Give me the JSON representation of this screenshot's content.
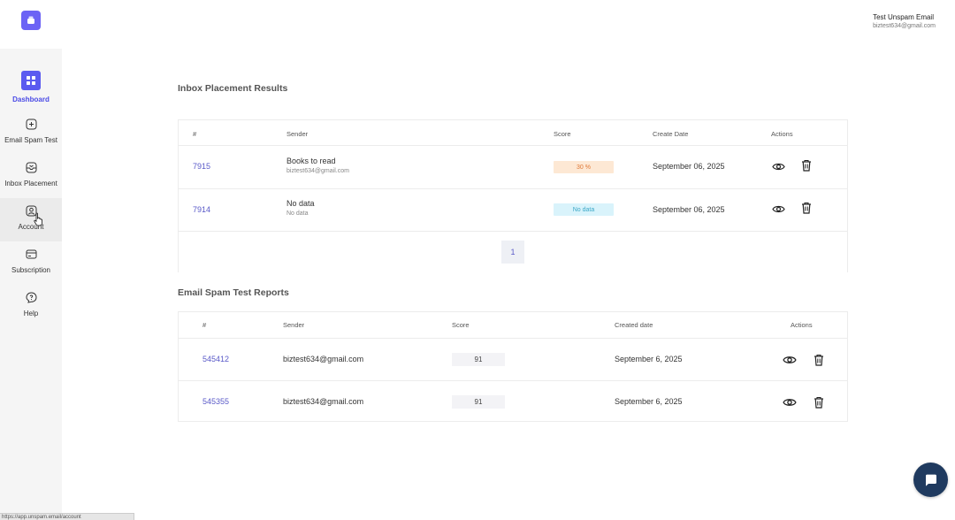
{
  "sidebar": {
    "items": [
      {
        "label": "Dashboard",
        "icon": "grid-icon"
      },
      {
        "label": "Email Spam Test",
        "icon": "plus-square-icon"
      },
      {
        "label": "Inbox Placement",
        "icon": "inbox-icon"
      },
      {
        "label": "Account",
        "icon": "user-icon"
      },
      {
        "label": "Subscription",
        "icon": "card-icon"
      },
      {
        "label": "Help",
        "icon": "help-icon"
      }
    ]
  },
  "user": {
    "name": "Test Unspam Email",
    "email": "biztest634@gmail.com"
  },
  "inbox": {
    "title": "Inbox Placement Results",
    "headers": [
      "#",
      "Sender",
      "Score",
      "Create Date",
      "Actions"
    ],
    "rows": [
      {
        "id": "7915",
        "sender": "Books to read",
        "sender_sub": "biztest634@gmail.com",
        "score": "30 %",
        "date": "September 06, 2025"
      },
      {
        "id": "7914",
        "sender": "No data",
        "sender_sub": "No data",
        "score": "No data",
        "date": "September 06, 2025"
      }
    ],
    "page": "1"
  },
  "spam": {
    "title": "Email Spam Test Reports",
    "headers": [
      "#",
      "Sender",
      "Score",
      "Created date",
      "Actions"
    ],
    "rows": [
      {
        "id": "545412",
        "sender": "biztest634@gmail.com",
        "score": "91",
        "date": "September 6, 2025"
      },
      {
        "id": "545355",
        "sender": "biztest634@gmail.com",
        "score": "91",
        "date": "September 6, 2025"
      }
    ]
  },
  "statusbar": {
    "text": "https://app.unspam.email/account"
  },
  "colors": {
    "accent": "#5b5bf0",
    "chat": "#1f3a5f",
    "score_bad_bg": "#fde8d4",
    "score_nodata_bg": "#d9f3fb"
  }
}
